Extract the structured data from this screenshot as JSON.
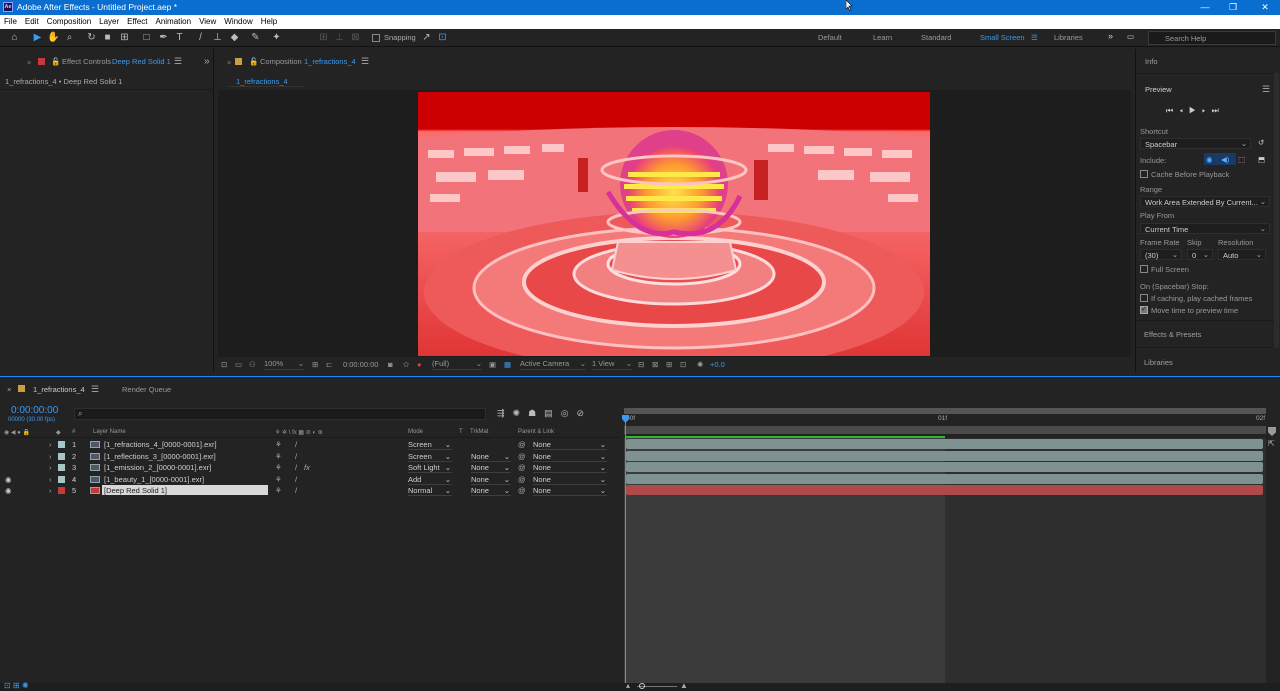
{
  "titlebar": {
    "app_icon": "Ae",
    "title": "Adobe After Effects - Untitled Project.aep *",
    "min": "—",
    "max": "❐",
    "close": "✕"
  },
  "menu": [
    "File",
    "Edit",
    "Composition",
    "Layer",
    "Effect",
    "Animation",
    "View",
    "Window",
    "Help"
  ],
  "toolbar": {
    "snapping": "Snapping",
    "workspaces": [
      "Default",
      "Learn",
      "Standard",
      "Small Screen",
      "Libraries"
    ],
    "active_workspace": "Small Screen",
    "search_placeholder": "Search Help",
    "accent": "#3a9bf0"
  },
  "effect_controls": {
    "tab_prefix": "Effect Controls",
    "tab_target": "Deep Red Solid 1",
    "crumb": "1_refractions_4 • Deep Red Solid 1"
  },
  "composition": {
    "tab_prefix": "Composition",
    "tab_target": "1_refractions_4",
    "subtab": "1_refractions_4"
  },
  "viewer_bar": {
    "zoom": "100%",
    "timecode": "0:00:00:00",
    "resolution": "(Full)",
    "camera": "Active Camera",
    "views": "1 View",
    "exposure": "+0.0"
  },
  "right_panel": {
    "info": "Info",
    "preview": "Preview",
    "shortcut_label": "Shortcut",
    "shortcut_value": "Spacebar",
    "include_label": "Include:",
    "cache_before_playback": "Cache Before Playback",
    "range_label": "Range",
    "range_value": "Work Area Extended By Current...",
    "play_from_label": "Play From",
    "play_from_value": "Current Time",
    "frame_rate_label": "Frame Rate",
    "skip_label": "Skip",
    "resolution_label": "Resolution",
    "frame_rate_value": "(30)",
    "skip_value": "0",
    "resolution_value": "Auto",
    "full_screen": "Full Screen",
    "on_stop_label": "On (Spacebar) Stop:",
    "if_caching": "If caching, play cached frames",
    "move_time": "Move time to preview time",
    "move_time_checked": true,
    "effects_presets": "Effects & Presets",
    "libraries": "Libraries"
  },
  "timeline": {
    "tab": "1_refractions_4",
    "render_queue": "Render Queue",
    "timecode": "0:00:00:00",
    "fps": "00000 (30.00 fps)",
    "ruler": [
      "00f",
      "01f",
      "02f"
    ],
    "headers": {
      "num": "#",
      "layer_name": "Layer Name",
      "mode": "Mode",
      "t": "T",
      "trkmat": "TrkMat",
      "parent": "Parent & Link"
    },
    "layers": [
      {
        "num": "1",
        "name": "[1_refractions_4_[0000-0001].exr]",
        "mode": "Screen",
        "trkmat": "",
        "parent": "None",
        "label_color": "#a7c7c7",
        "visible": false,
        "fx": false
      },
      {
        "num": "2",
        "name": "[1_reflections_3_[0000-0001].exr]",
        "mode": "Screen",
        "trkmat": "None",
        "parent": "None",
        "label_color": "#a7c7c7",
        "visible": false,
        "fx": false
      },
      {
        "num": "3",
        "name": "[1_emission_2_[0000-0001].exr]",
        "mode": "Soft Light",
        "trkmat": "None",
        "parent": "None",
        "label_color": "#a7c7c7",
        "visible": false,
        "fx": true
      },
      {
        "num": "4",
        "name": "[1_beauty_1_[0000-0001].exr]",
        "mode": "Add",
        "trkmat": "None",
        "parent": "None",
        "label_color": "#a7c7c7",
        "visible": true,
        "fx": false
      },
      {
        "num": "5",
        "name": "[Deep Red Solid 1]",
        "mode": "Normal",
        "trkmat": "None",
        "parent": "None",
        "label_color": "#c83838",
        "visible": true,
        "fx": false,
        "selected": true
      }
    ]
  }
}
